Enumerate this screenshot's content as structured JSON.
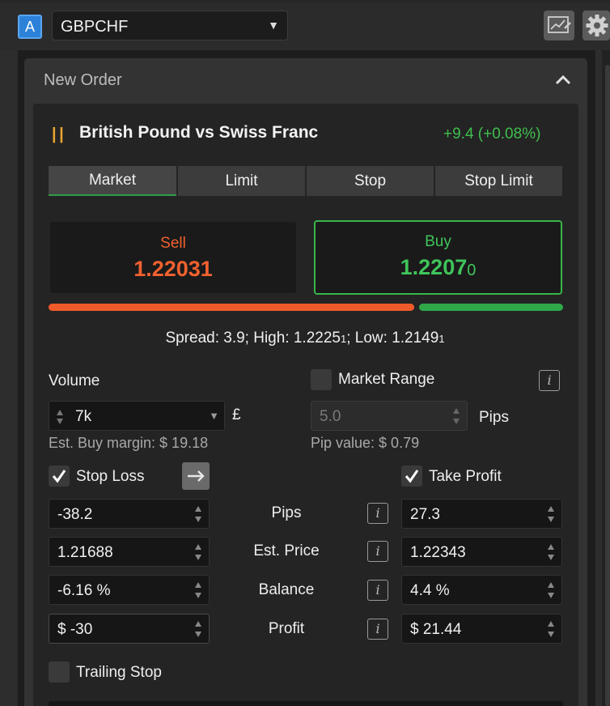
{
  "toolbar": {
    "account_badge": "A",
    "symbol": "GBPCHF"
  },
  "panel": {
    "title": "New Order"
  },
  "instrument": {
    "name": "British Pound vs Swiss Franc",
    "change": "+9.4 (+0.08%)"
  },
  "order_tabs": [
    "Market",
    "Limit",
    "Stop",
    "Stop Limit"
  ],
  "active_tab": 0,
  "sell": {
    "label": "Sell",
    "price_main": "1.22031",
    "price_sub": ""
  },
  "buy": {
    "label": "Buy",
    "price_main": "1.2207",
    "price_sub": "0"
  },
  "spread_bar": {
    "sell_fraction": 0.71
  },
  "market_stats": {
    "spread_text": "Spread: 3.9; High: 1.2225",
    "high_sub": "1",
    "low_text": "; Low: 1.2149",
    "low_sub": "1"
  },
  "volume": {
    "label": "Volume",
    "value": "7k",
    "currency": "£",
    "margin_text": "Est. Buy margin: $ 19.18"
  },
  "market_range": {
    "label": "Market Range",
    "placeholder": "5.0",
    "unit": "Pips",
    "pip_value_text": "Pip value: $ 0.79"
  },
  "stop_loss": {
    "label": "Stop Loss",
    "pips": "-38.2",
    "est_price": "1.21688",
    "balance": "-6.16 %",
    "profit": "$ -30"
  },
  "take_profit": {
    "label": "Take Profit",
    "pips": "27.3",
    "est_price": "1.22343",
    "balance": "4.4 %",
    "profit": "$ 21.44"
  },
  "row_labels": {
    "pips": "Pips",
    "est_price": "Est. Price",
    "balance": "Balance",
    "profit": "Profit"
  },
  "info_glyph": "i",
  "trailing_stop": {
    "label": "Trailing Stop"
  },
  "colors": {
    "sell": "#f0612f",
    "buy": "#3fc45a",
    "accent_tab": "#2e9c4a"
  }
}
